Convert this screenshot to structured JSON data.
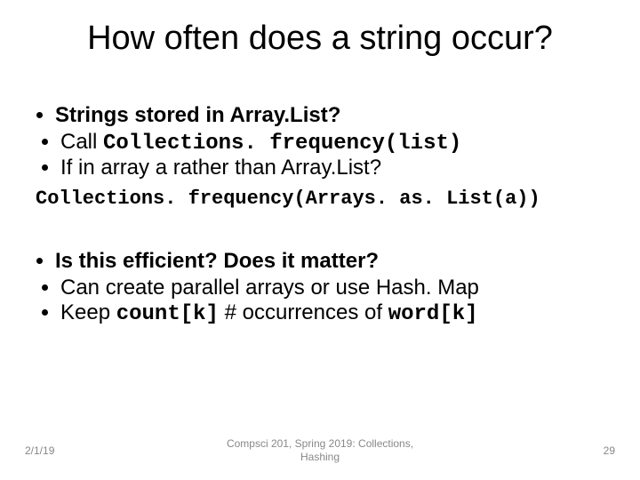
{
  "title": "How often does a string occur?",
  "bullets": {
    "q1": "Strings stored in Array.List?",
    "q1_sub_prefix": "Call ",
    "q1_sub_code": "Collections. frequency(list)",
    "q1_sub2": "If in array a rather than Array.List?",
    "codeblock": "Collections. frequency(Arrays. as. List(a))",
    "q2": "Is this efficient? Does it matter?",
    "q2_sub1": "Can create parallel arrays or use Hash. Map",
    "q2_sub2_prefix": "Keep ",
    "q2_sub2_code1": "count[k]",
    "q2_sub2_mid": "  # occurrences of ",
    "q2_sub2_code2": "word[k]"
  },
  "footer": {
    "date": "2/1/19",
    "center_line1": "Compsci 201, Spring 2019: Collections,",
    "center_line2": "Hashing",
    "pageno": "29"
  }
}
